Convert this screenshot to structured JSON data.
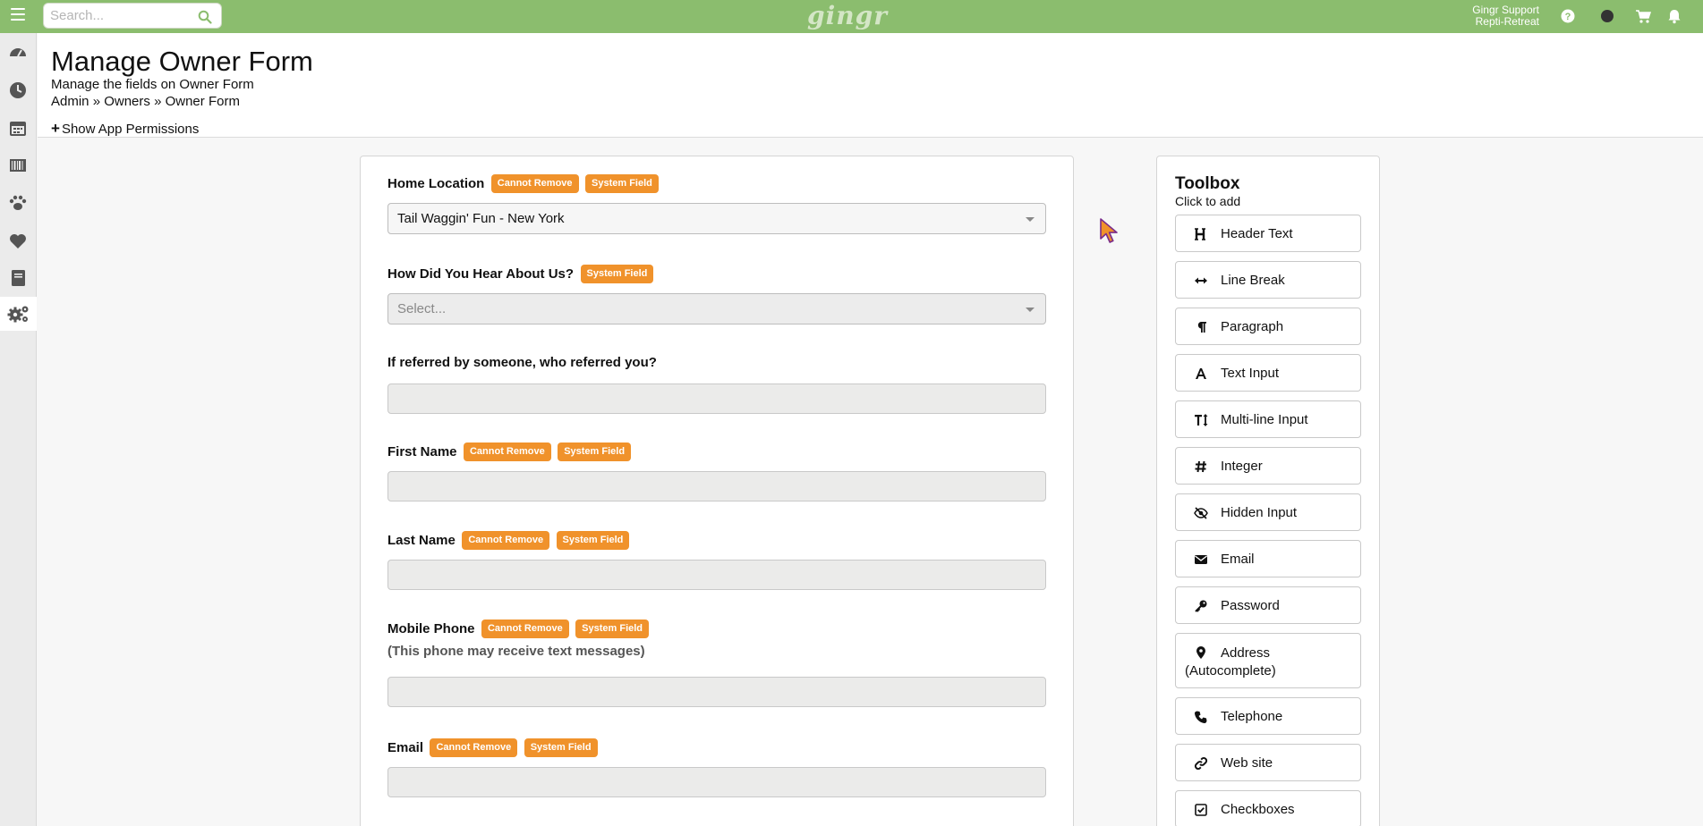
{
  "topbar": {
    "search_placeholder": "Search...",
    "logo": "gingr",
    "user_name": "Gingr Support",
    "user_org": "Repti-Retreat",
    "icons": [
      "help-icon",
      "status-dot-icon",
      "cart-icon",
      "bell-icon"
    ]
  },
  "sidebar": {
    "items": [
      {
        "icon": "dashboard-icon"
      },
      {
        "icon": "clock-icon"
      },
      {
        "icon": "calendar-icon"
      },
      {
        "icon": "barcode-icon"
      },
      {
        "icon": "paw-icon"
      },
      {
        "icon": "heart-icon"
      },
      {
        "icon": "book-icon"
      },
      {
        "icon": "gears-icon",
        "active": true
      }
    ]
  },
  "header": {
    "title": "Manage Owner Form",
    "subtitle": "Manage the fields on Owner Form",
    "breadcrumb": [
      "Admin",
      "Owners",
      "Owner Form"
    ],
    "breadcrumb_sep": "»",
    "permissions_link": "Show App Permissions"
  },
  "badges": {
    "cannot_remove": "Cannot Remove",
    "system_field": "System Field"
  },
  "form": {
    "fields": [
      {
        "label": "Home Location",
        "type": "select",
        "value": "Tail Waggin' Fun - New York"
      },
      {
        "label": "How Did You Hear About Us?",
        "type": "select",
        "placeholder": "Select..."
      },
      {
        "label": "If referred by someone, who referred you?",
        "type": "text"
      },
      {
        "label": "First Name",
        "type": "text"
      },
      {
        "label": "Last Name",
        "type": "text"
      },
      {
        "label": "Mobile Phone",
        "type": "text",
        "note": "(This phone may receive text messages)"
      },
      {
        "label": "Email",
        "type": "text"
      }
    ]
  },
  "toolbox": {
    "title": "Toolbox",
    "subtitle": "Click to add",
    "items": [
      {
        "label": "Header Text",
        "icon": "header-h-icon"
      },
      {
        "label": "Line Break",
        "icon": "arrows-horizontal-icon"
      },
      {
        "label": "Paragraph",
        "icon": "paragraph-icon"
      },
      {
        "label": "Text Input",
        "icon": "letter-a-icon"
      },
      {
        "label": "Multi-line Input",
        "icon": "text-height-icon"
      },
      {
        "label": "Integer",
        "icon": "hash-icon"
      },
      {
        "label": "Hidden Input",
        "icon": "eye-slash-icon"
      },
      {
        "label": "Email",
        "icon": "envelope-icon"
      },
      {
        "label": "Password",
        "icon": "key-icon"
      },
      {
        "label": "Address (Autocomplete)",
        "icon": "map-marker-icon"
      },
      {
        "label": "Telephone",
        "icon": "phone-icon"
      },
      {
        "label": "Web site",
        "icon": "link-icon"
      },
      {
        "label": "Checkboxes",
        "icon": "checkbox-icon"
      }
    ]
  }
}
